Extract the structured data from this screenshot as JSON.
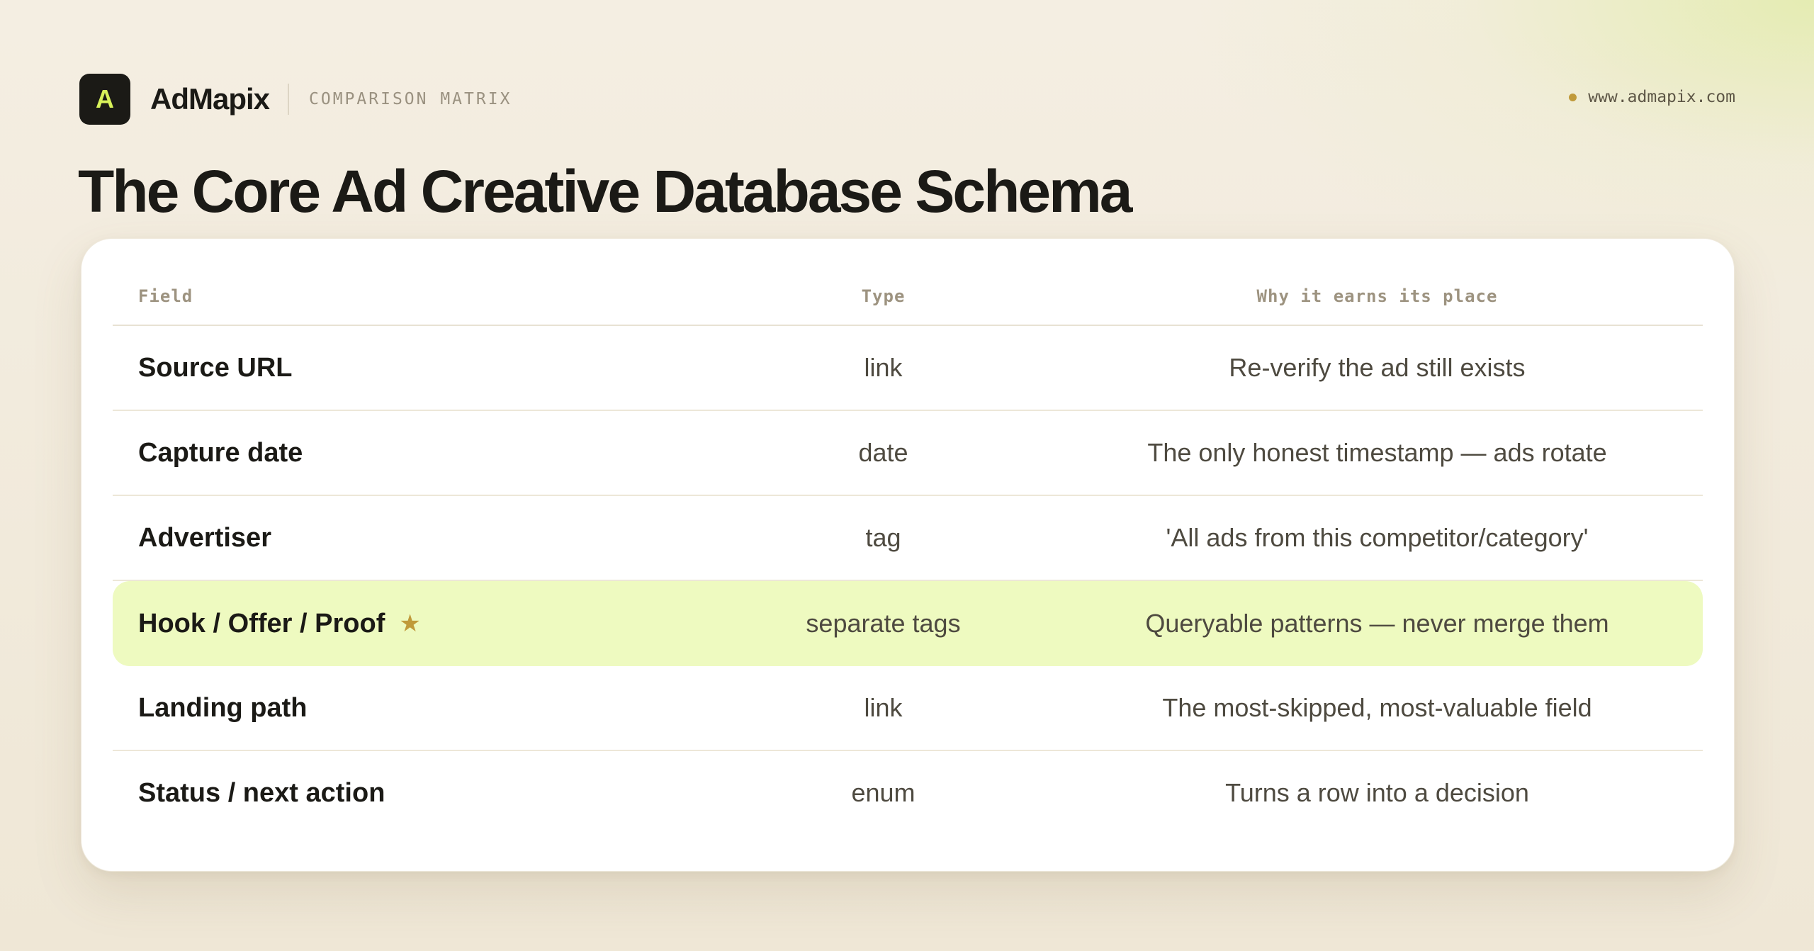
{
  "header": {
    "logo_letter": "A",
    "brand": "AdMapix",
    "subtitle": "COMPARISON MATRIX",
    "site_url": "www.admapix.com"
  },
  "page_title": "The Core Ad Creative Database Schema",
  "table": {
    "columns": [
      "Field",
      "Type",
      "Why it earns its place"
    ],
    "rows": [
      {
        "field": "Source URL",
        "type": "link",
        "why": "Re-verify the ad still exists",
        "highlighted": false
      },
      {
        "field": "Capture date",
        "type": "date",
        "why": "The only honest timestamp — ads rotate",
        "highlighted": false
      },
      {
        "field": "Advertiser",
        "type": "tag",
        "why": "'All ads from this competitor/category'",
        "highlighted": false
      },
      {
        "field": "Hook / Offer / Proof",
        "type": "separate tags",
        "why": "Queryable patterns — never merge them",
        "highlighted": true,
        "icon": "star-icon"
      },
      {
        "field": "Landing path",
        "type": "link",
        "why": "The most-skipped, most-valuable field",
        "highlighted": false
      },
      {
        "field": "Status / next action",
        "type": "enum",
        "why": "Turns a row into a decision",
        "highlighted": false
      }
    ]
  },
  "colors": {
    "accent": "#d8f25a",
    "highlight_row": "#eefac0",
    "star": "#c09a3a",
    "dark": "#1b1a16"
  }
}
